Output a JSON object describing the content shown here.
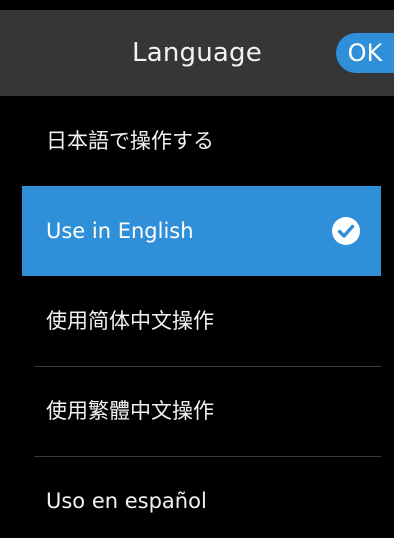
{
  "header": {
    "title": "Language",
    "ok_label": "OK"
  },
  "languages": [
    {
      "label": "日本語で操作する",
      "selected": false
    },
    {
      "label": "Use in English",
      "selected": true
    },
    {
      "label": "使用简体中文操作",
      "selected": false
    },
    {
      "label": "使用繁體中文操作",
      "selected": false
    },
    {
      "label": "Uso en español",
      "selected": false
    }
  ],
  "colors": {
    "accent": "#2f8fd8",
    "header_bg": "#363636",
    "background": "#000000",
    "text": "#f2f2f2"
  },
  "icons": {
    "selected_marker": "check-circle-icon"
  }
}
